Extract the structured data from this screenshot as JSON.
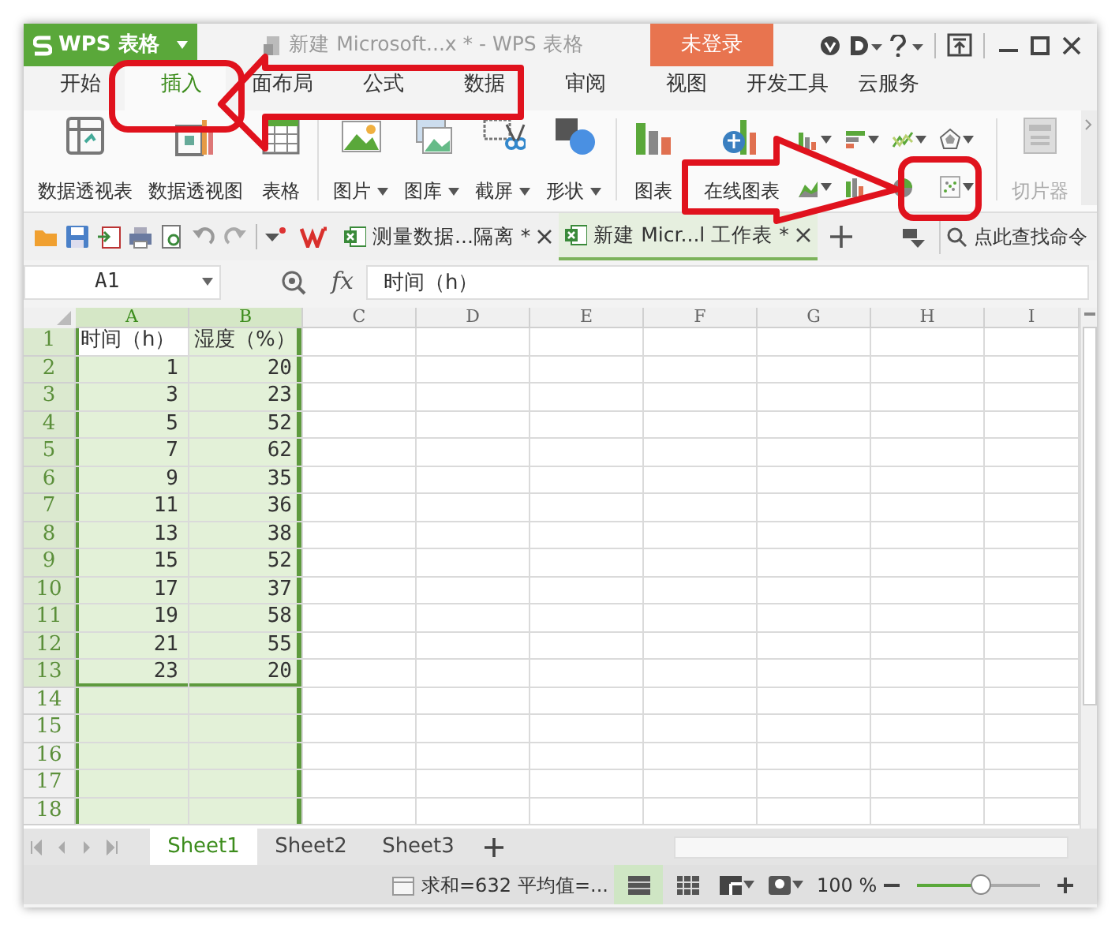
{
  "window": {
    "app_button": "WPS 表格",
    "title": "新建 Microsoft...x * - WPS 表格",
    "login_button": "未登录"
  },
  "menu_tabs": [
    {
      "label": "开始",
      "selected": false
    },
    {
      "label": "插入",
      "selected": true
    },
    {
      "label": "面布局",
      "selected": false
    },
    {
      "label": "公式",
      "selected": false
    },
    {
      "label": "数据",
      "selected": false
    },
    {
      "label": "审阅",
      "selected": false
    },
    {
      "label": "视图",
      "selected": false
    },
    {
      "label": "开发工具",
      "selected": false
    },
    {
      "label": "云服务",
      "selected": false
    }
  ],
  "ribbon": {
    "groups": [
      {
        "buttons": [
          {
            "label": "数据透视表",
            "dropdown": false,
            "disabled": false
          },
          {
            "label": "数据透视图",
            "dropdown": false,
            "disabled": false
          },
          {
            "label": "表格",
            "dropdown": false,
            "disabled": false
          }
        ]
      },
      {
        "buttons": [
          {
            "label": "图片",
            "dropdown": true,
            "disabled": false
          },
          {
            "label": "图库",
            "dropdown": true,
            "disabled": false
          },
          {
            "label": "截屏",
            "dropdown": true,
            "disabled": false
          },
          {
            "label": "形状",
            "dropdown": true,
            "disabled": false
          }
        ]
      },
      {
        "buttons": [
          {
            "label": "图表",
            "dropdown": false,
            "disabled": false
          },
          {
            "label": "在线图表",
            "dropdown": false,
            "disabled": false
          }
        ],
        "small_buttons": [
          {
            "dropdown": true
          },
          {
            "dropdown": true
          },
          {
            "dropdown": true
          },
          {
            "dropdown": true
          },
          {
            "dropdown": true
          },
          {
            "dropdown": false
          },
          {
            "dropdown": false
          },
          {
            "dropdown": true
          }
        ]
      },
      {
        "buttons": [
          {
            "label": "切片器",
            "dropdown": false,
            "disabled": true
          }
        ]
      }
    ]
  },
  "document_tabs": [
    {
      "label": "测量数据...隔离 *",
      "selected": false
    },
    {
      "label": "新建 Micr...l 工作表 *",
      "selected": true
    }
  ],
  "command_search": {
    "placeholder": "点此查找命令"
  },
  "formula_bar": {
    "name_box": "A1",
    "fx": "fx",
    "formula": "时间（h）"
  },
  "sheet": {
    "columns": [
      {
        "label": "A",
        "selected": true
      },
      {
        "label": "B",
        "selected": true
      },
      {
        "label": "C",
        "selected": false
      },
      {
        "label": "D",
        "selected": false
      },
      {
        "label": "E",
        "selected": false
      },
      {
        "label": "F",
        "selected": false
      },
      {
        "label": "G",
        "selected": false
      },
      {
        "label": "H",
        "selected": false
      },
      {
        "label": "I",
        "selected": false
      }
    ],
    "rows": [
      {
        "label": "1",
        "selected": true,
        "cells": [
          {
            "kind": "text",
            "text": "时间（h）",
            "active": true
          },
          {
            "kind": "text",
            "text": "湿度（%）",
            "active": false
          }
        ]
      },
      {
        "label": "2",
        "selected": true,
        "cells": [
          {
            "kind": "number",
            "text": "1",
            "active": false
          },
          {
            "kind": "number",
            "text": "20",
            "active": false
          }
        ]
      },
      {
        "label": "3",
        "selected": true,
        "cells": [
          {
            "kind": "number",
            "text": "3",
            "active": false
          },
          {
            "kind": "number",
            "text": "23",
            "active": false
          }
        ]
      },
      {
        "label": "4",
        "selected": true,
        "cells": [
          {
            "kind": "number",
            "text": "5",
            "active": false
          },
          {
            "kind": "number",
            "text": "52",
            "active": false
          }
        ]
      },
      {
        "label": "5",
        "selected": true,
        "cells": [
          {
            "kind": "number",
            "text": "7",
            "active": false
          },
          {
            "kind": "number",
            "text": "62",
            "active": false
          }
        ]
      },
      {
        "label": "6",
        "selected": true,
        "cells": [
          {
            "kind": "number",
            "text": "9",
            "active": false
          },
          {
            "kind": "number",
            "text": "35",
            "active": false
          }
        ]
      },
      {
        "label": "7",
        "selected": true,
        "cells": [
          {
            "kind": "number",
            "text": "11",
            "active": false
          },
          {
            "kind": "number",
            "text": "36",
            "active": false
          }
        ]
      },
      {
        "label": "8",
        "selected": true,
        "cells": [
          {
            "kind": "number",
            "text": "13",
            "active": false
          },
          {
            "kind": "number",
            "text": "38",
            "active": false
          }
        ]
      },
      {
        "label": "9",
        "selected": true,
        "cells": [
          {
            "kind": "number",
            "text": "15",
            "active": false
          },
          {
            "kind": "number",
            "text": "52",
            "active": false
          }
        ]
      },
      {
        "label": "10",
        "selected": true,
        "cells": [
          {
            "kind": "number",
            "text": "17",
            "active": false
          },
          {
            "kind": "number",
            "text": "37",
            "active": false
          }
        ]
      },
      {
        "label": "11",
        "selected": true,
        "cells": [
          {
            "kind": "number",
            "text": "19",
            "active": false
          },
          {
            "kind": "number",
            "text": "58",
            "active": false
          }
        ]
      },
      {
        "label": "12",
        "selected": true,
        "cells": [
          {
            "kind": "number",
            "text": "21",
            "active": false
          },
          {
            "kind": "number",
            "text": "55",
            "active": false
          }
        ]
      },
      {
        "label": "13",
        "selected": true,
        "cells": [
          {
            "kind": "number",
            "text": "23",
            "active": false
          },
          {
            "kind": "number",
            "text": "20",
            "active": false
          }
        ]
      },
      {
        "label": "14",
        "selected": false,
        "cells": []
      },
      {
        "label": "15",
        "selected": false,
        "cells": []
      },
      {
        "label": "16",
        "selected": false,
        "cells": []
      },
      {
        "label": "17",
        "selected": false,
        "cells": []
      },
      {
        "label": "18",
        "selected": false,
        "cells": []
      }
    ]
  },
  "sheet_tabs": [
    {
      "label": "Sheet1",
      "selected": true
    },
    {
      "label": "Sheet2",
      "selected": false
    },
    {
      "label": "Sheet3",
      "selected": false
    }
  ],
  "status_bar": {
    "sum": "求和=632",
    "average": "平均值=...",
    "views": [
      {
        "selected": true
      },
      {
        "selected": false
      },
      {
        "selected": false
      },
      {
        "selected": false
      }
    ],
    "zoom": "100 %",
    "zoom_slider": {
      "level": 0.47
    }
  },
  "annotations": [
    {
      "kind": "ring"
    },
    {
      "kind": "left-arrow"
    },
    {
      "kind": "right-arrow"
    },
    {
      "kind": "ring"
    }
  ]
}
